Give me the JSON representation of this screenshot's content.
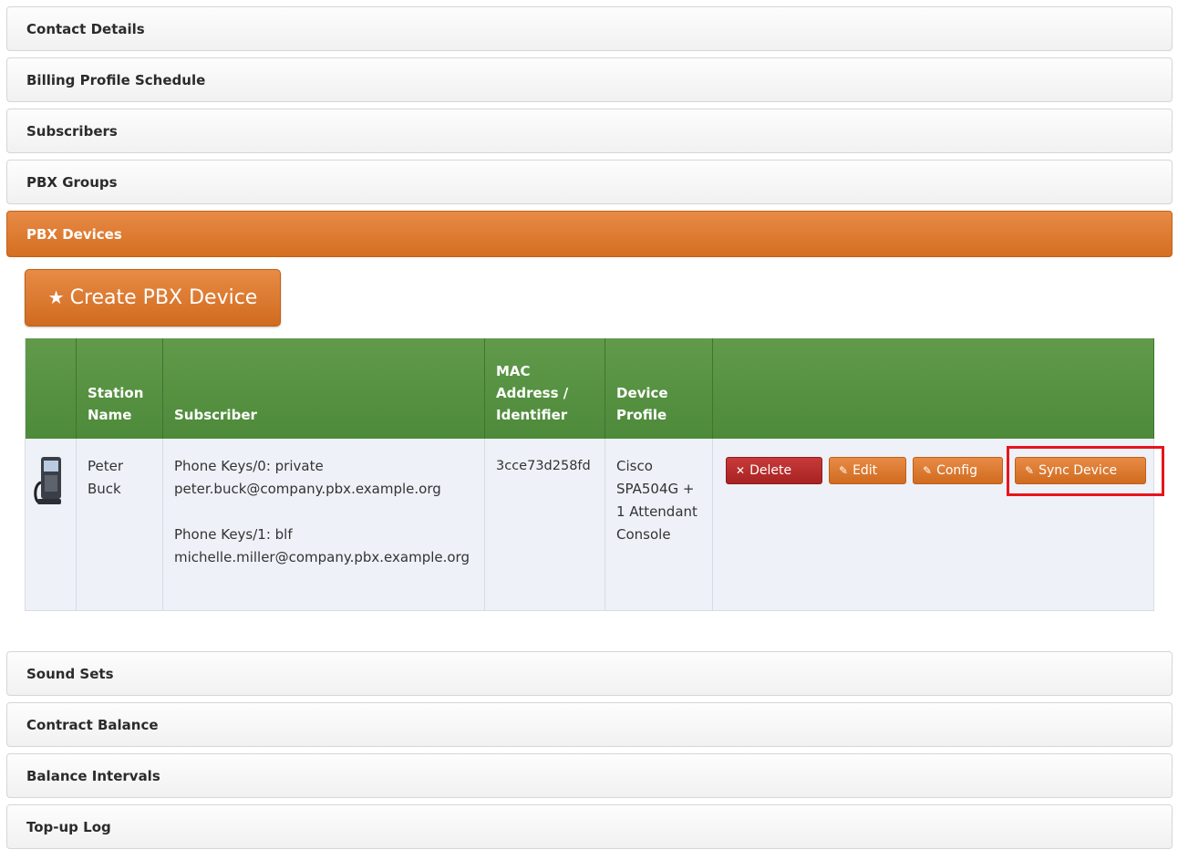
{
  "panels_top": [
    {
      "title": "Contact Details"
    },
    {
      "title": "Billing Profile Schedule"
    },
    {
      "title": "Subscribers"
    },
    {
      "title": "PBX Groups"
    },
    {
      "title": "PBX Devices"
    }
  ],
  "create_button": {
    "label": "Create PBX Device",
    "icon": "star-icon"
  },
  "table": {
    "headers": [
      "",
      "Station Name",
      "Subscriber",
      "MAC Address / Identifier",
      "Device Profile",
      ""
    ],
    "rows": [
      {
        "station_name": "Peter Buck",
        "subscriber_lines": [
          "Phone Keys/0: private",
          "peter.buck@company.pbx.example.org",
          "Phone Keys/1: blf",
          "michelle.miller@company.pbx.example.org"
        ],
        "mac": "3cce73d258fd",
        "profile": "Cisco SPA504G + 1 Attendant Console",
        "actions": {
          "delete": "Delete",
          "edit": "Edit",
          "config": "Config",
          "sync": "Sync Device"
        }
      }
    ]
  },
  "panels_bottom": [
    {
      "title": "Sound Sets"
    },
    {
      "title": "Contract Balance"
    },
    {
      "title": "Balance Intervals"
    },
    {
      "title": "Top-up Log"
    }
  ],
  "colors": {
    "accent_orange": "#d46e22",
    "header_green": "#4d8a3a",
    "danger_red": "#a82222",
    "highlight": "#e8141b"
  }
}
